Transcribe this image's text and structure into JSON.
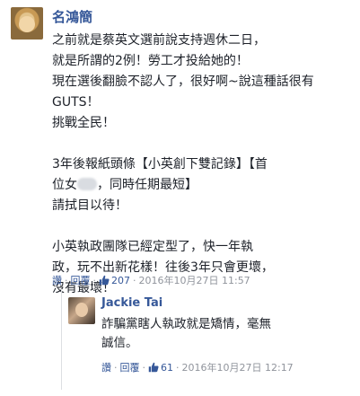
{
  "main_comment": {
    "author": "名鴻簡",
    "text_lines": [
      "之前就是蔡英文選前說支持週休二日，",
      "就是所謂的2例！勞工才投給她的！",
      "現在選後翻臉不認人了，很好啊~說這種",
      "話很有GUTS！",
      "挑戰全民！",
      "",
      "3年後報紙頭條【小英創下雙記錄】【首",
      "位女",
      "請拭目以待！",
      "",
      "小英執政團隊已經定型了，快一年執",
      "政，玩不出新花樣！往後3年只會更壞，",
      "沒有最壞！"
    ],
    "blurred_line_rest": "，同時任期最短】",
    "actions": {
      "like_label": "讚",
      "reply_label": "回覆",
      "like_count": "207",
      "timestamp": "2016年10月27日 11:57"
    }
  },
  "reply": {
    "author": "Jackie Tai",
    "text_lines": [
      "詐騙黨瞎人執政就是矯情，毫無",
      "誠信。"
    ],
    "actions": {
      "like_label": "讚",
      "reply_label": "回覆",
      "like_count": "61",
      "timestamp": "2016年10月27日 12:17"
    }
  },
  "colors": {
    "link": "#365899",
    "meta": "#90949c",
    "text": "#1d2129"
  }
}
